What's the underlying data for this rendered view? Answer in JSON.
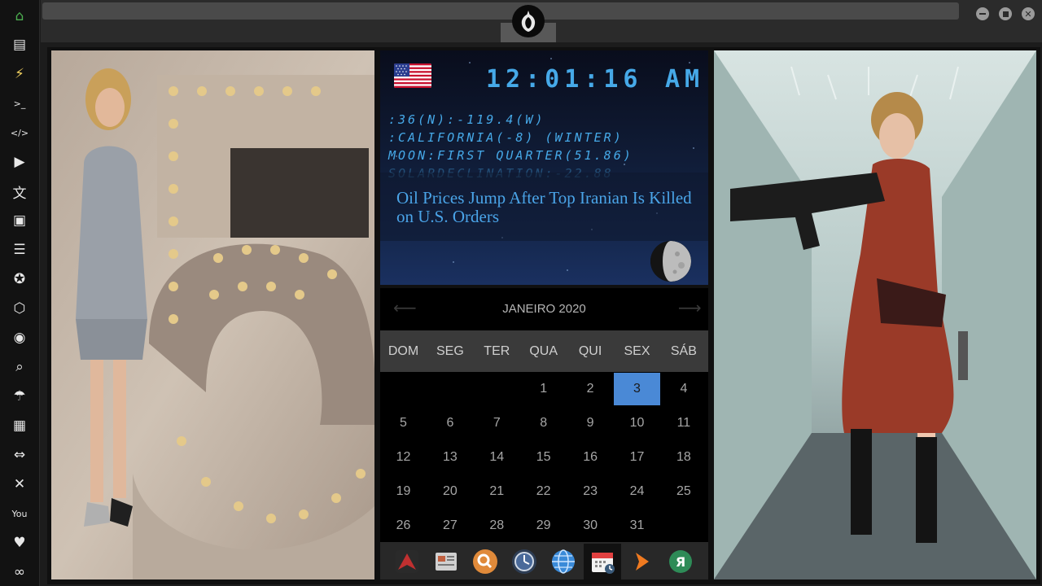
{
  "sidebar": {
    "items": [
      {
        "name": "home",
        "icon": "⌂",
        "color": "#4caf50"
      },
      {
        "name": "document",
        "icon": "▤"
      },
      {
        "name": "power",
        "icon": "⚡",
        "color": "#f0d060"
      },
      {
        "name": "terminal",
        "icon": ">_"
      },
      {
        "name": "code",
        "icon": "</>"
      },
      {
        "name": "play",
        "icon": "▶"
      },
      {
        "name": "translate",
        "icon": "文"
      },
      {
        "name": "image",
        "icon": "▣"
      },
      {
        "name": "news",
        "icon": "☰"
      },
      {
        "name": "rebel",
        "icon": "✪"
      },
      {
        "name": "cube",
        "icon": "⬡"
      },
      {
        "name": "globe",
        "icon": "◉"
      },
      {
        "name": "search",
        "icon": "⌕"
      },
      {
        "name": "umbrella",
        "icon": "☂"
      },
      {
        "name": "contacts",
        "icon": "▦"
      },
      {
        "name": "link",
        "icon": "⇔"
      },
      {
        "name": "fullscreen",
        "icon": "✕"
      },
      {
        "name": "youtube",
        "icon": "You"
      },
      {
        "name": "heart",
        "icon": "♥"
      },
      {
        "name": "infinity",
        "icon": "∞"
      }
    ]
  },
  "clock": {
    "time": "12:01:16",
    "ampm": "AM",
    "lines": [
      ":36(N):-119.4(W)",
      ":CALIFORNIA(-8) (WINTER)",
      "MOON:FIRST QUARTER(51.86)",
      "SOLARDECLINATION:-22.88"
    ]
  },
  "news": {
    "headline": "Oil Prices Jump After Top Iranian Is Killed on U.S. Orders"
  },
  "calendar": {
    "month_label": "JANEIRO 2020",
    "weekdays": [
      "DOM",
      "SEG",
      "TER",
      "QUA",
      "QUI",
      "SEX",
      "SÁB"
    ],
    "first_weekday_index": 3,
    "days_in_month": 31,
    "today": 3
  },
  "dock": {
    "items": [
      {
        "name": "launcher",
        "color": "#c03030"
      },
      {
        "name": "news-reader",
        "color": "#d0d0d0"
      },
      {
        "name": "search",
        "color": "#e08a3a"
      },
      {
        "name": "clock",
        "color": "#4a6a9a"
      },
      {
        "name": "web-browser",
        "color": "#3a8ad8"
      },
      {
        "name": "calendar",
        "color": "#e04040",
        "active": true
      },
      {
        "name": "forward",
        "color": "#f07a20"
      },
      {
        "name": "yandex",
        "color": "#2e8b57"
      }
    ]
  }
}
